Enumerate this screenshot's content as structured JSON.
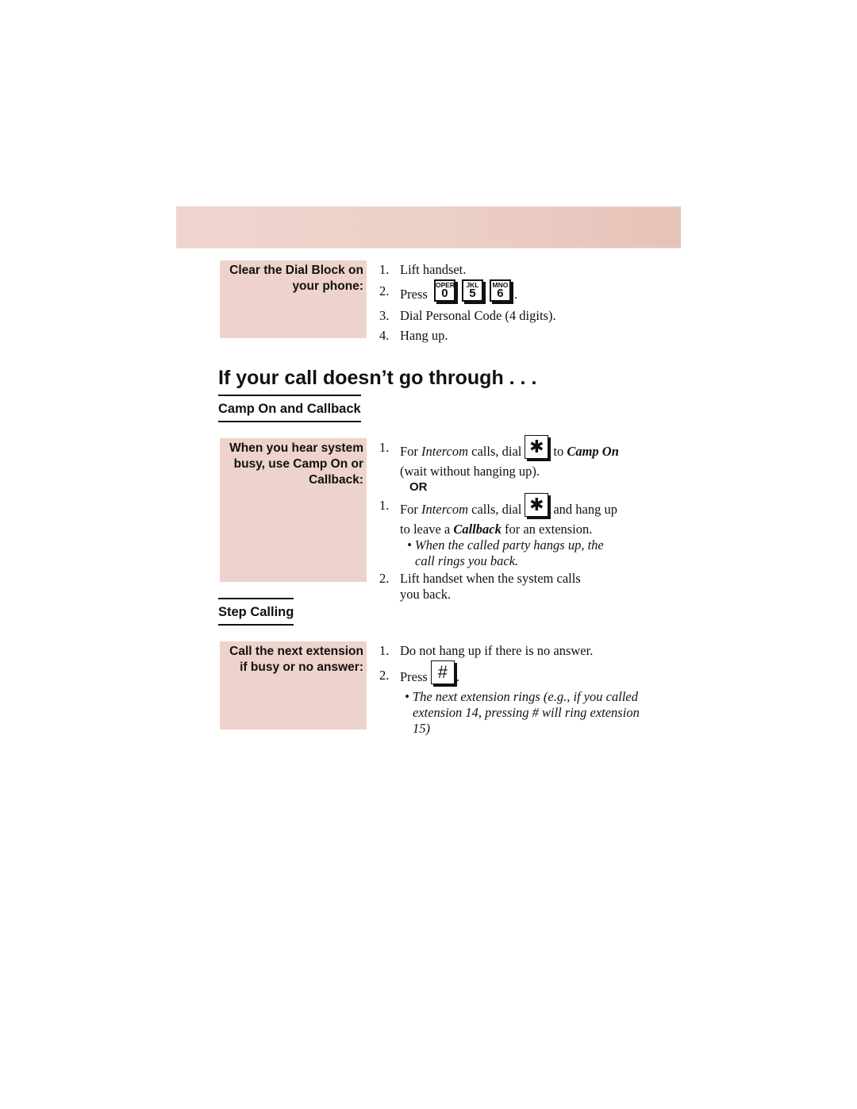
{
  "banner": {
    "color_start": "#f0d5cf",
    "color_end": "#e6c2b8"
  },
  "dial_block": {
    "label": "Clear the Dial Block on your phone:",
    "steps": [
      {
        "num": "1.",
        "text": "Lift handset."
      },
      {
        "num": "2.",
        "text_before": "Press",
        "text_after": ".",
        "keys": [
          {
            "icon": "key-0-icon",
            "sub": "OPER",
            "main": "0"
          },
          {
            "icon": "key-5-icon",
            "sub": "JKL",
            "main": "5"
          },
          {
            "icon": "key-6-icon",
            "sub": "MNO",
            "main": "6"
          }
        ]
      },
      {
        "num": "3.",
        "text": "Dial Personal Code (4 digits)."
      },
      {
        "num": "4.",
        "text": "Hang up."
      }
    ]
  },
  "section_title": "If your call doesn’t go through . . .",
  "camp_on": {
    "heading": "Camp On and Callback",
    "label": "When you hear system busy, use Camp On or Callback:",
    "step1a": {
      "num": "1.",
      "pre": "For ",
      "italic": "Intercom",
      "mid": " calls, dial",
      "key": "✱",
      "post": "to ",
      "bold_italic": "Camp On",
      "cont": "(wait without hanging up)."
    },
    "or_label": "OR",
    "step1b": {
      "num": "1.",
      "pre": "For ",
      "italic": "Intercom",
      "mid": " calls, dial",
      "key": "✱",
      "post": "and hang up",
      "cont_pre": "to leave a ",
      "bold_italic": "Callback",
      "cont_post": " for an extension."
    },
    "note": "• When the called party hangs up, the call rings you back.",
    "step2": {
      "num": "2.",
      "text": "Lift handset when the system calls you back."
    }
  },
  "step_calling": {
    "heading": "Step Calling",
    "label": "Call the next extension if busy or no answer:",
    "step1": {
      "num": "1.",
      "text": "Do not hang up if there is no answer."
    },
    "step2": {
      "num": "2.",
      "text_before": "Press",
      "key": "#",
      "text_after": "."
    },
    "note": "• The next extension rings (e.g., if you called extension 14, pressing # will ring extension 15)"
  }
}
